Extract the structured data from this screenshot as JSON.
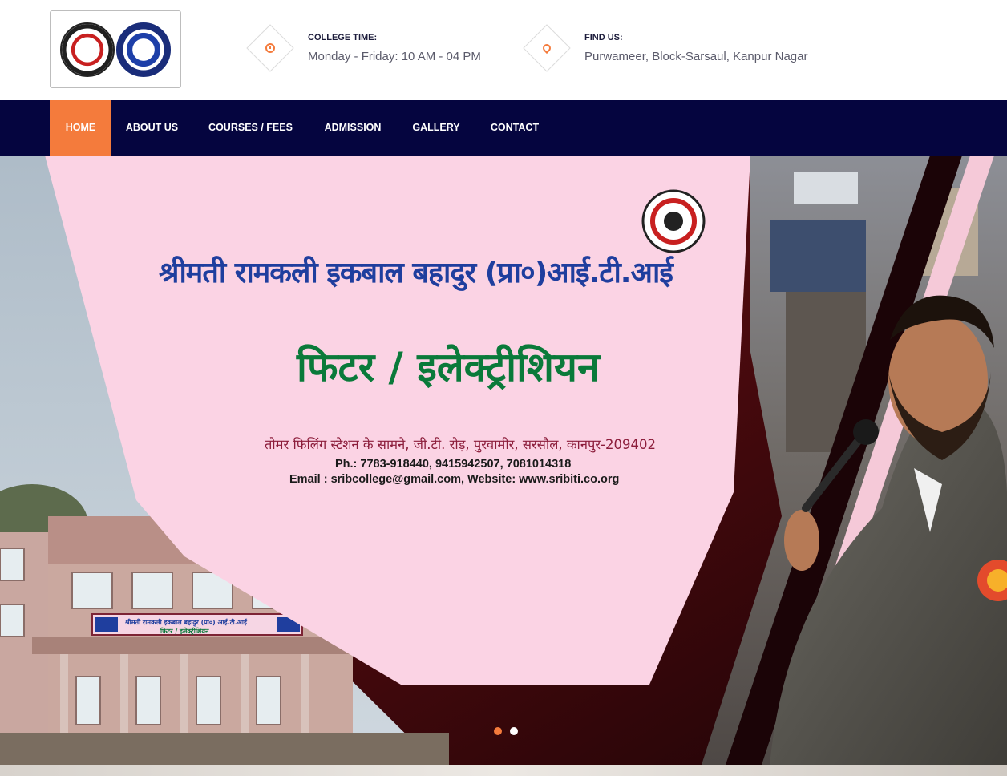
{
  "header": {
    "college_time": {
      "label": "COLLEGE TIME:",
      "value": "Monday - Friday: 10 AM - 04 PM",
      "icon": "clock-icon"
    },
    "find_us": {
      "label": "FIND US:",
      "value": "Purwameer, Block-Sarsaul, Kanpur Nagar",
      "icon": "map-pin-icon"
    }
  },
  "nav": {
    "items": [
      {
        "label": "HOME",
        "active": true
      },
      {
        "label": "ABOUT US"
      },
      {
        "label": "COURSES / FEES"
      },
      {
        "label": "ADMISSION"
      },
      {
        "label": "GALLERY"
      },
      {
        "label": "CONTACT"
      }
    ]
  },
  "banner": {
    "title": "श्रीमती रामकली इकबाल बहादुर (प्रा०)आई.टी.आई",
    "trades": "फिटर / इलेक्ट्रीशियन",
    "address": "तोमर फिलिंग स्टेशन के सामने, जी.टी. रोड़, पुरवामीर, सरसौल, कानपुर-209402",
    "phone": "Ph.: 7783-918440, 9415942507, 7081014318",
    "email": "Email : sribcollege@gmail.com, Website: www.sribiti.co.org",
    "building_signboard_title": "श्रीमती रामकली इकबाल बहादुर (प्रा०) आई.टी.आई",
    "building_signboard_trades": "फिटर / इलेक्ट्रीशियन"
  },
  "slider": {
    "total": 2,
    "current": 1
  },
  "colors": {
    "accent": "#f47b3c",
    "nav_bg": "#05053f",
    "banner_bg": "#fbd3e4",
    "title_blue": "#1f3e9e",
    "trade_green": "#0a7a3a",
    "address_red": "#8c1d3b"
  }
}
